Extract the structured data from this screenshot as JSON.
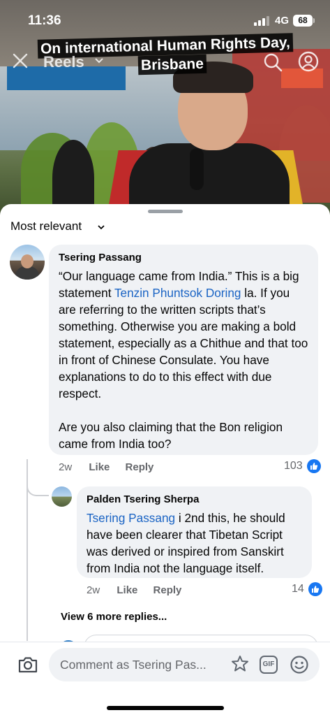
{
  "status_bar": {
    "time": "11:36",
    "network": "4G",
    "battery": "68"
  },
  "video": {
    "caption_line1": "On international Human Rights Day,",
    "caption_line2": "Brisbane",
    "nav_label": "Reels"
  },
  "comments_sheet": {
    "sort_label": "Most relevant",
    "comments": [
      {
        "author": "Tsering Passang",
        "text_part1": "“Our language came from India.” This is a big statement ",
        "mention": "Tenzin Phuntsok Doring",
        "text_part2": " la. If you are referring to the written scripts that’s something. Otherwise you are making a bold statement, especially as a Chithue and that too in front of Chinese Consulate. You have explanations to do to this effect with due respect.\n\nAre you also claiming that the Bon religion came from India too?",
        "age": "2w",
        "like_label": "Like",
        "reply_label": "Reply",
        "reaction_count": "103"
      },
      {
        "author": "Palden Tsering Sherpa",
        "mention": "Tsering Passang",
        "text": " i 2nd this, he should have been clearer that Tibetan Script was derived or inspired from Sanskirt from India not the language itself.",
        "age": "2w",
        "like_label": "Like",
        "reply_label": "Reply",
        "reaction_count": "14"
      }
    ],
    "view_more_label": "View 6 more replies..."
  },
  "composer": {
    "placeholder": "Comment as Tsering Pas...",
    "gif_label": "GIF"
  },
  "colors": {
    "accent": "#1877f2",
    "mention": "#1b64c4",
    "bubble": "#f0f2f5"
  }
}
